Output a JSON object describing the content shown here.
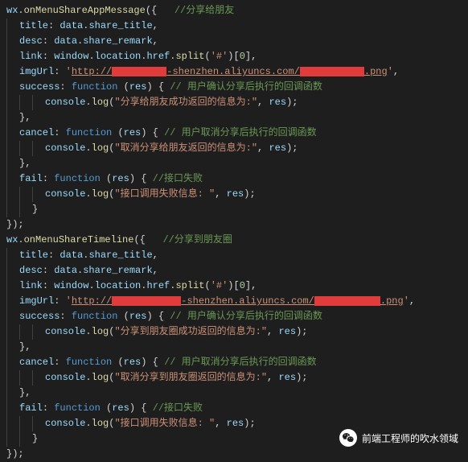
{
  "code": {
    "wx": "wx",
    "dot": ".",
    "onMenuShareAppMessage": "onMenuShareAppMessage",
    "onMenuShareTimeline": "onMenuShareTimeline",
    "openParen": "(",
    "closeParen": ")",
    "openBrace": "{",
    "closeBrace": "}",
    "openBracket": "[",
    "closeBracket": "]",
    "semicolon": ";",
    "colon": ":",
    "comma": ",",
    "title": "title",
    "desc": "desc",
    "link": "link",
    "imgUrl": "imgUrl",
    "success": "success",
    "cancel": "cancel",
    "fail": "fail",
    "data": "data",
    "share_title": "share_title",
    "share_remark": "share_remark",
    "window": "window",
    "location": "location",
    "href": "href",
    "split": "split",
    "hashStr": "'#'",
    "zero": "0",
    "httpPrefix": "'",
    "httpUrl": "http://",
    "urlMid1": "-shenzhen.aliyuncs.com/",
    "urlMid2": "-shenzhen.aliyuncs.com/",
    "urlPng": ".png",
    "httpSuffix": "'",
    "function": "function",
    "res": "res",
    "console": "console",
    "log": "log"
  },
  "comments": {
    "shareFriend": "//分享给朋友",
    "confirmCallback": "// 用户确认分享后执行的回调函数",
    "cancelCallback": "// 用户取消分享后执行的回调函数",
    "apiFail": "//接口失败",
    "shareTimeline": "//分享到朋友圈"
  },
  "strings": {
    "shareFriendSuccess": "\"分享给朋友成功返回的信息为:\"",
    "cancelFriendReturn": "\"取消分享给朋友返回的信息为:\"",
    "apiFailInfo": "\"接口调用失败信息: \"",
    "shareTimelineSuccess": "\"分享到朋友圈成功返回的信息为:\"",
    "cancelTimelineReturn": "\"取消分享到朋友圈返回的信息为:\""
  },
  "watermark": {
    "text": "前端工程师的吹水领域"
  }
}
